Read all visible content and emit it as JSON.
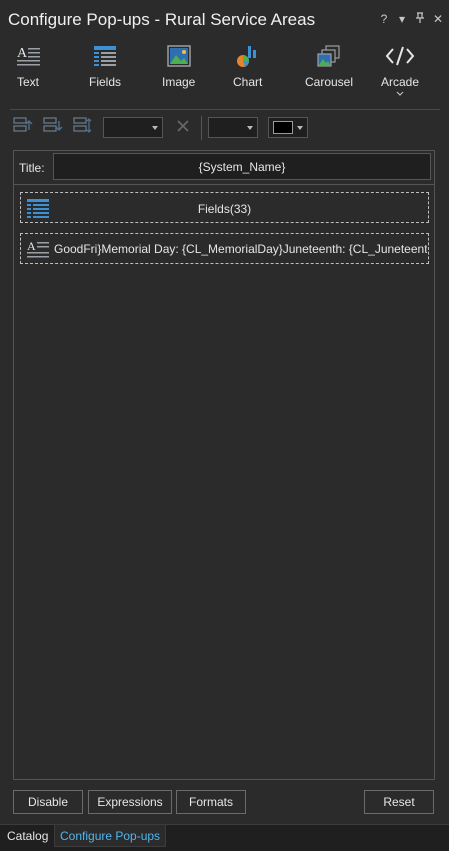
{
  "window": {
    "title": "Configure Pop-ups - Rural Service Areas",
    "controls": {
      "help": "?",
      "menu": "▾",
      "pin": "⊤",
      "close": "✕"
    }
  },
  "ribbon": {
    "items": [
      {
        "label": "Text",
        "icon": "text-icon"
      },
      {
        "label": "Fields",
        "icon": "fields-icon"
      },
      {
        "label": "Image",
        "icon": "image-icon"
      },
      {
        "label": "Chart",
        "icon": "chart-icon"
      },
      {
        "label": "Carousel",
        "icon": "carousel-icon"
      },
      {
        "label": "Arcade",
        "icon": "arcade-icon"
      }
    ]
  },
  "toolbar": {
    "tools": [
      "move-up-icon",
      "move-down-icon",
      "move-elements-icon",
      "delete-icon"
    ],
    "font_combo": "",
    "size_combo": "",
    "color": "#000000"
  },
  "panel": {
    "title_label": "Title:",
    "title_value": "{System_Name}",
    "elements": [
      {
        "type": "fields",
        "text": "Fields(33)"
      },
      {
        "type": "text",
        "text": "GoodFri}Memorial Day: {CL_MemorialDay}Juneteenth: {CL_Juneteenth}"
      }
    ]
  },
  "buttons": {
    "disable": "Disable",
    "expressions": "Expressions",
    "formats": "Formats",
    "reset": "Reset"
  },
  "tabs": [
    {
      "label": "Catalog",
      "active": false
    },
    {
      "label": "Configure Pop-ups",
      "active": true
    }
  ],
  "colors": {
    "background": "#2b2b2b",
    "accent": "#4fb6f2",
    "input_bg": "#1f1f1f"
  }
}
